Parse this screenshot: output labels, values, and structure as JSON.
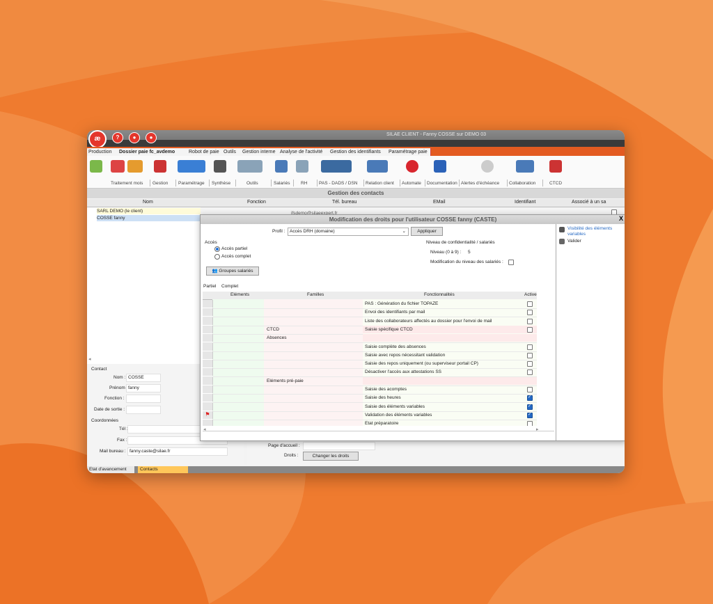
{
  "window": {
    "title": "SILAE CLIENT - Fanny COSSE sur DEMO 03"
  },
  "titlebar_buttons": [
    {
      "icon": "logo-icon",
      "glyph": "æ"
    },
    {
      "icon": "help-icon",
      "glyph": "?"
    },
    {
      "icon": "chat-icon",
      "glyph": "●"
    },
    {
      "icon": "update-icon",
      "glyph": "●"
    }
  ],
  "tabs": [
    {
      "label": "Production"
    },
    {
      "label": "Dossier paie fc_avdemo",
      "active": true
    },
    {
      "label": "Robot de paie"
    },
    {
      "label": "Outils"
    },
    {
      "label": "Gestion interne"
    },
    {
      "label": "Analyse de l'activité"
    },
    {
      "label": "Gestion des identifiants"
    },
    {
      "label": "Paramétrage paie"
    }
  ],
  "ribbon_groups": [
    {
      "label": "Traitement mois"
    },
    {
      "label": "Gestion"
    },
    {
      "label": "Paramétrage"
    },
    {
      "label": "Synthèse"
    },
    {
      "label": "Outils"
    },
    {
      "label": "Salariés"
    },
    {
      "label": "RH"
    },
    {
      "label": "PAS - DADS / DSN"
    },
    {
      "label": "Relation client"
    },
    {
      "label": "Automate"
    },
    {
      "label": "Documentation"
    },
    {
      "label": "Alertes d'échéance"
    },
    {
      "label": "Collaboration"
    },
    {
      "label": "CTCD"
    }
  ],
  "section_title": "Gestion des contacts",
  "contacts_table": {
    "columns": [
      "Nom",
      "Fonction",
      "Tél. bureau",
      "EMail",
      "Identifiant",
      "Associé à un sa"
    ],
    "rows": [
      {
        "nom": "SARL DEMO (le client)",
        "email": "ifsdemo@silaeexpert.fr"
      },
      {
        "nom": "COSSE fanny",
        "email": ""
      }
    ]
  },
  "contact_panel": {
    "section_contact": "Contact",
    "nom_label": "Nom :",
    "nom": "COSSE",
    "prenom_label": "Prénom :",
    "prenom": "fanny",
    "fonction_label": "Fonction :",
    "date_sortie_label": "Date de sortie :",
    "section_coord": "Coordonnées",
    "tel_label": "Tél :",
    "fax_label": "Fax :",
    "mail_label": "Mail bureau :",
    "mail": "fanny.caste@silae.fr",
    "page_accueil_label": "Page d'accueil :",
    "droits_label": "Droits :",
    "changer_droits": "Changer les droits"
  },
  "bottom_tabs": [
    {
      "label": "Etat d'avancement"
    },
    {
      "label": "Contacts",
      "active": true
    }
  ],
  "modal": {
    "title": "Modification des droits pour l'utilisateur COSSE fanny (CASTE)",
    "close": "X",
    "profil_label": "Profil :",
    "profil_value": "Accès DRH (domaine)",
    "appliquer": "Appliquer",
    "acces_label": "Accès",
    "acces_partiel": "Accès partiel",
    "acces_complet": "Accès complet",
    "niveau_title": "Niveau de confidentialité  / salariés",
    "niveau_label": "Niveau (0 à 9) :",
    "niveau_value": "5",
    "modif_niveau": "Modification du niveau des salariés :",
    "groupes": "Groupes salariés",
    "subtab_partiel": "Partiel",
    "subtab_complet": "Complet",
    "grid_headers": [
      "Eléments",
      "Familles",
      "Fonctionnalités",
      "Active"
    ],
    "rows": [
      {
        "famille": "",
        "fn": "PAS : Génération du fichier TOPAZE",
        "active": false,
        "hasChk": true
      },
      {
        "famille": "",
        "fn": "Envoi des identifiants par mail",
        "active": false,
        "hasChk": true
      },
      {
        "famille": "",
        "fn": "Liste des collaborateurs affectés au dossier pour l'envoi de mail",
        "active": false,
        "hasChk": true
      },
      {
        "famille": "CTCD",
        "fn": "Saisie spécifique CTCD",
        "active": false,
        "hasChk": true,
        "pink": true
      },
      {
        "famille": "Absences",
        "fn": "",
        "active": false,
        "hasChk": false,
        "pink": true
      },
      {
        "famille": "",
        "fn": "Saisie complète des absences",
        "active": false,
        "hasChk": true
      },
      {
        "famille": "",
        "fn": "Saisie avec repos nécessitant validation",
        "active": false,
        "hasChk": true
      },
      {
        "famille": "",
        "fn": "Saisie des repos uniquement (ou superviseur portail CP)",
        "active": false,
        "hasChk": true
      },
      {
        "famille": "",
        "fn": "Désactiver l'accès aux attestations SS",
        "active": false,
        "hasChk": true
      },
      {
        "famille": "Eléments pré-paie",
        "fn": "",
        "active": false,
        "hasChk": false,
        "pink": true
      },
      {
        "famille": "",
        "fn": "Saisie des acomptes",
        "active": false,
        "hasChk": true
      },
      {
        "famille": "",
        "fn": "Saisie des heures",
        "active": true,
        "hasChk": true
      },
      {
        "famille": "",
        "fn": "Saisie des éléments variables",
        "active": true,
        "hasChk": true
      },
      {
        "famille": "",
        "fn": "Validation des éléments variables",
        "active": true,
        "hasChk": true,
        "flag": true
      },
      {
        "famille": "",
        "fn": "Etat préparatoire",
        "active": false,
        "hasChk": true
      }
    ],
    "side_items": [
      {
        "icon": "visibility-icon",
        "label": "Visibilité des éléments variables",
        "link": true
      },
      {
        "icon": "validate-icon",
        "label": "Valider",
        "link": false
      }
    ]
  },
  "colors": {
    "accent": "#e35b21",
    "background": "#ee7a2e",
    "link": "#2a6cc4"
  }
}
